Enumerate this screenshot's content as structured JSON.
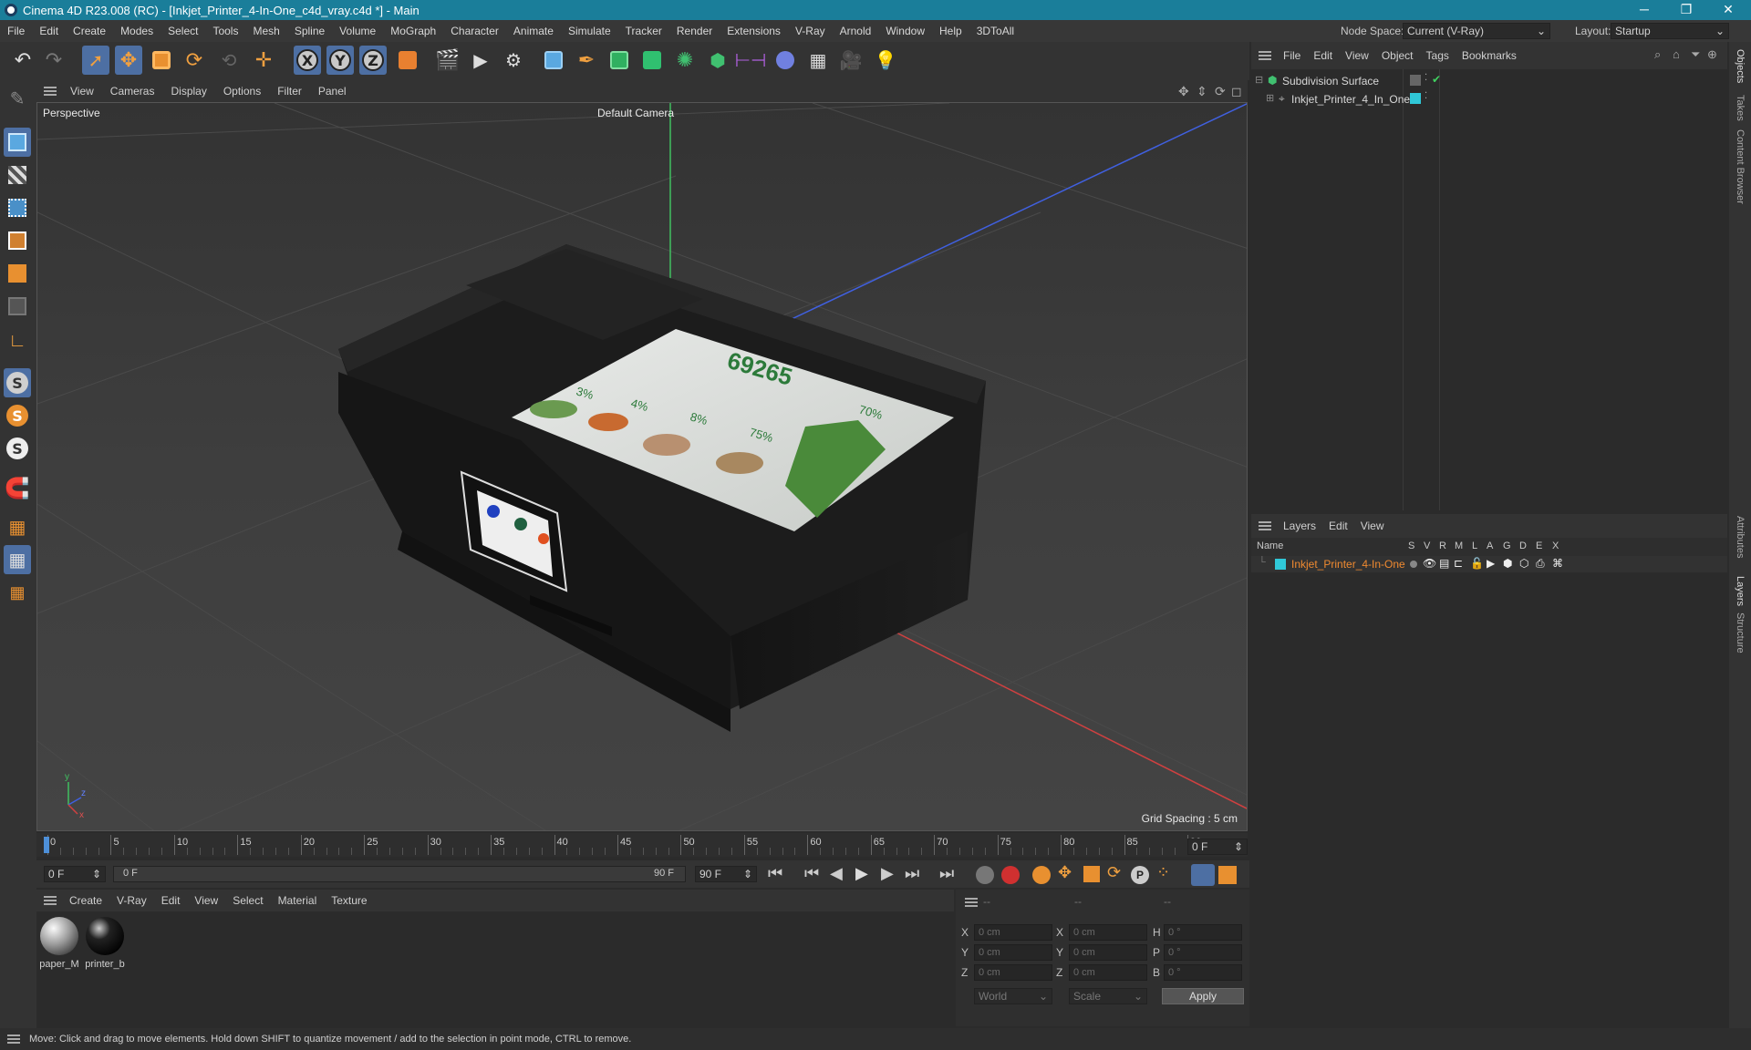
{
  "window": {
    "title": "Cinema 4D R23.008 (RC) - [Inkjet_Printer_4-In-One_c4d_vray.c4d *] - Main",
    "minimize": "─",
    "restore": "❐",
    "close": "✕"
  },
  "menubar": {
    "items": [
      "File",
      "Edit",
      "Create",
      "Modes",
      "Select",
      "Tools",
      "Mesh",
      "Spline",
      "Volume",
      "MoGraph",
      "Character",
      "Animate",
      "Simulate",
      "Tracker",
      "Render",
      "Extensions",
      "V-Ray",
      "Arnold",
      "Window",
      "Help",
      "3DToAll"
    ],
    "node_space_label": "Node Space:",
    "node_space_value": "Current (V-Ray)",
    "layout_label": "Layout:",
    "layout_value": "Startup"
  },
  "viewport": {
    "menu": [
      "View",
      "Cameras",
      "Display",
      "Options",
      "Filter",
      "Panel"
    ],
    "label": "Perspective",
    "camera": "Default Camera",
    "grid_spacing": "Grid Spacing : 5 cm",
    "axis_y": "y",
    "axis_z": "z",
    "axis_x": "x",
    "screen": {
      "headline": "69265",
      "pct1": "3%",
      "pct2": "4%",
      "pct3": "8%",
      "pct4": "75%",
      "pct5": "70%"
    }
  },
  "timeline": {
    "ticks": [
      "0",
      "5",
      "10",
      "15",
      "20",
      "25",
      "30",
      "35",
      "40",
      "45",
      "50",
      "55",
      "60",
      "65",
      "70",
      "75",
      "80",
      "85",
      "90"
    ],
    "current_frame": "0 F",
    "start_field": "0 F",
    "range_start": "0 F",
    "range_end": "90 F",
    "end_field": "90 F"
  },
  "materials": {
    "menu": [
      "Create",
      "V-Ray",
      "Edit",
      "View",
      "Select",
      "Material",
      "Texture"
    ],
    "items": [
      {
        "name": "paper_M"
      },
      {
        "name": "printer_b"
      }
    ]
  },
  "coordinates": {
    "headers": [
      "--",
      "--",
      "--"
    ],
    "rows": [
      {
        "a": "X",
        "av": "0 cm",
        "b": "X",
        "bv": "0 cm",
        "c": "H",
        "cv": "0 °"
      },
      {
        "a": "Y",
        "av": "0 cm",
        "b": "Y",
        "bv": "0 cm",
        "c": "P",
        "cv": "0 °"
      },
      {
        "a": "Z",
        "av": "0 cm",
        "b": "Z",
        "bv": "0 cm",
        "c": "B",
        "cv": "0 °"
      }
    ],
    "mode": "World",
    "transform": "Scale",
    "apply": "Apply"
  },
  "objects": {
    "menu": [
      "File",
      "Edit",
      "View",
      "Object",
      "Tags",
      "Bookmarks"
    ],
    "tree": [
      {
        "name": "Subdivision Surface"
      },
      {
        "name": "Inkjet_Printer_4_In_One"
      }
    ]
  },
  "layers": {
    "menu": [
      "Layers",
      "Edit",
      "View"
    ],
    "columns": [
      "Name",
      "S",
      "V",
      "R",
      "M",
      "L",
      "A",
      "G",
      "D",
      "E",
      "X"
    ],
    "items": [
      {
        "name": "Inkjet_Printer_4-In-One"
      }
    ]
  },
  "side_tabs": [
    "Objects",
    "Takes",
    "Content Browser",
    "Attributes",
    "Layers",
    "Structure"
  ],
  "status": "Move: Click and drag to move elements. Hold down SHIFT to quantize movement / add to the selection in point mode, CTRL to remove.",
  "colors": {
    "titlebar": "#1a7e9a",
    "selection": "#4d6fa3",
    "axis_x": "#d04040",
    "axis_y": "#40c060",
    "axis_z": "#4060e0",
    "layer_color": "#30c8d8",
    "layer_text": "#f08a30"
  }
}
